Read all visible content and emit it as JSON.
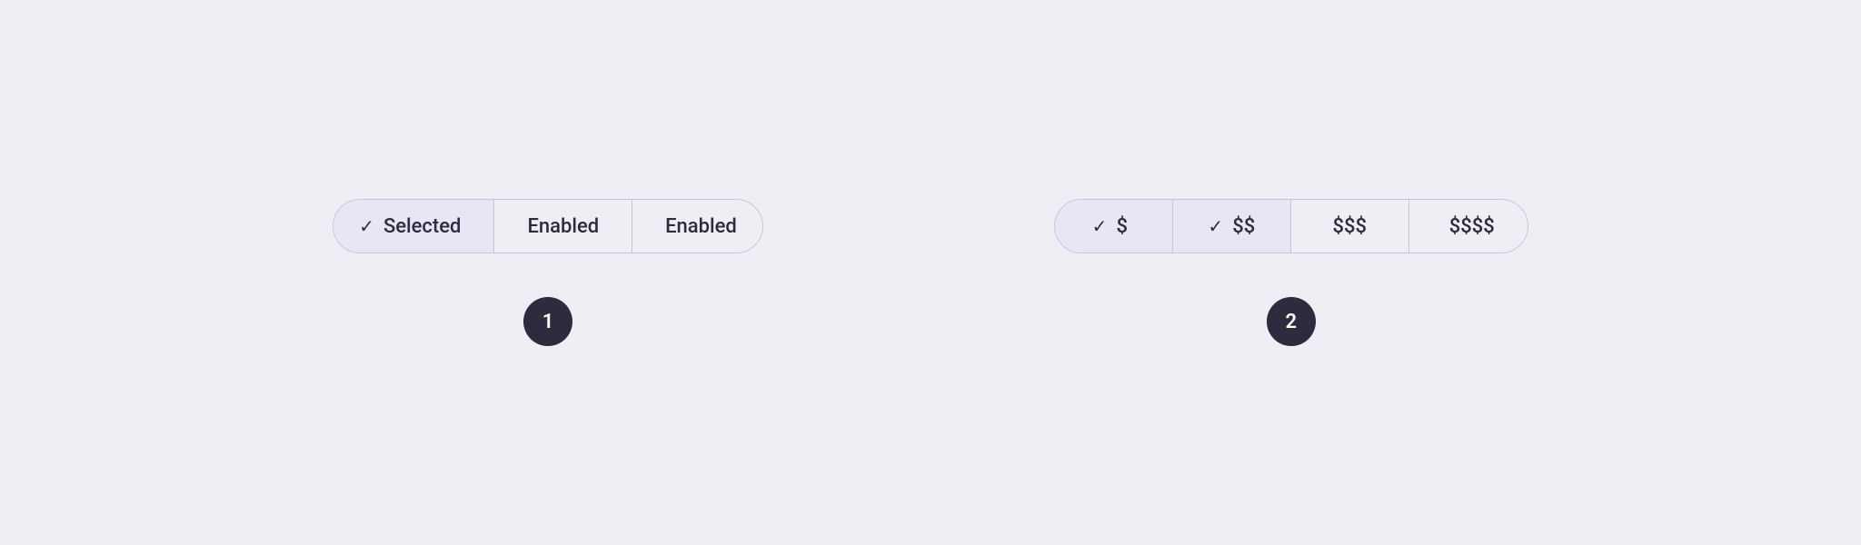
{
  "section1": {
    "control": {
      "segments": [
        {
          "label": "Selected",
          "selected": true,
          "hasCheck": true
        },
        {
          "label": "Enabled",
          "selected": false,
          "hasCheck": false
        },
        {
          "label": "Enabled",
          "selected": false,
          "hasCheck": false
        }
      ]
    },
    "badge": {
      "label": "1"
    }
  },
  "section2": {
    "control": {
      "segments": [
        {
          "label": "$",
          "selected": true,
          "hasCheck": true
        },
        {
          "label": "$$",
          "selected": true,
          "hasCheck": true
        },
        {
          "label": "$$$",
          "selected": false,
          "hasCheck": false
        },
        {
          "label": "$$$$",
          "selected": false,
          "hasCheck": false
        }
      ]
    },
    "badge": {
      "label": "2"
    }
  }
}
